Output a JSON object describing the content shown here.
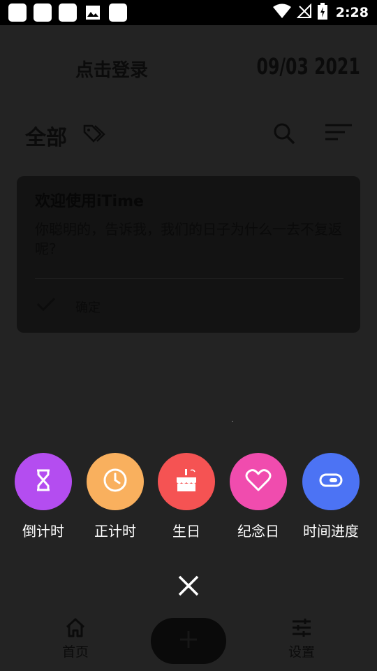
{
  "status_bar": {
    "time": "2:28",
    "icons": [
      "notification-square-icon",
      "notification-square-icon",
      "notification-square-icon",
      "image-icon",
      "notification-square-icon",
      "wifi-icon",
      "no-signal-icon",
      "battery-charging-icon"
    ]
  },
  "header": {
    "login_label": "点击登录",
    "date": "09/03 2021"
  },
  "filter": {
    "label": "全部"
  },
  "card": {
    "title": "欢迎使用iTime",
    "body": "你聪明的，告诉我，我们的日子为什么一去不复返呢?",
    "confirm_label": "确定"
  },
  "quick_menu": {
    "items": [
      {
        "label": "倒计时",
        "color": "#B44DF0",
        "icon": "hourglass-icon"
      },
      {
        "label": "正计时",
        "color": "#F9B05E",
        "icon": "clock-icon"
      },
      {
        "label": "生日",
        "color": "#F55353",
        "icon": "cake-icon"
      },
      {
        "label": "纪念日",
        "color": "#F04CAE",
        "icon": "heart-icon"
      },
      {
        "label": "时间进度",
        "color": "#4C73F4",
        "icon": "toggle-icon"
      }
    ]
  },
  "bottom_nav": {
    "home_label": "首页",
    "settings_label": "设置"
  }
}
